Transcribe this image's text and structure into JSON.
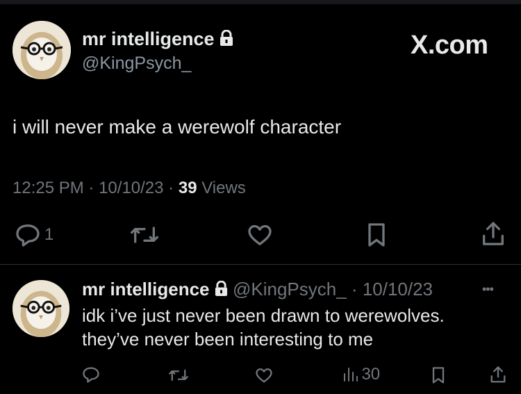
{
  "brand": {
    "wordmark": "X.com",
    "accent": "#e7e9ea",
    "muted": "#71767b"
  },
  "main_tweet": {
    "author_name": "mr intelligence",
    "author_handle": "@KingPsych_",
    "text": "i will never make a werewolf character",
    "time": "12:25 PM",
    "date": "10/10/23",
    "views_count": "39",
    "views_label": "Views",
    "reply_count": "1",
    "sep": "·"
  },
  "reply_tweet": {
    "author_name": "mr intelligence",
    "author_handle": "@KingPsych_",
    "date": "10/10/23",
    "sep": "·",
    "text_line1": "idk i’ve just never been drawn to werewolves.",
    "text_line2": "they’ve never been interesting to me",
    "views_count": "30",
    "more": "•••"
  },
  "icons": [
    "lock-icon",
    "reply-icon",
    "retweet-icon",
    "like-icon",
    "bookmark-icon",
    "share-icon",
    "views-icon"
  ]
}
